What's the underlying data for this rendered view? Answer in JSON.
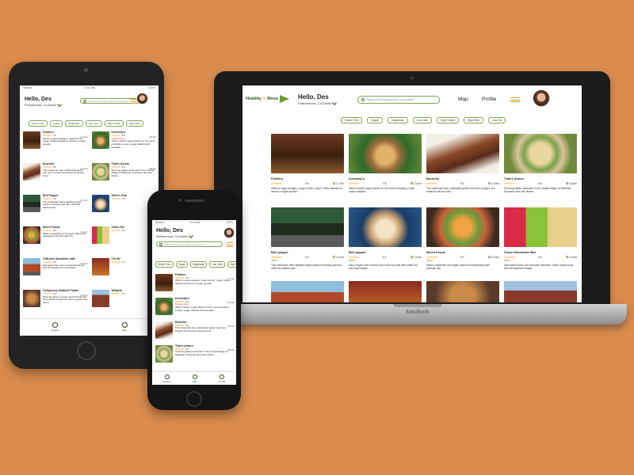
{
  "colors": {
    "background": "#DA8C4E",
    "accent_green": "#7fa64b",
    "star": "#f2a614",
    "open": "#5a9a2d",
    "closing": "#d9332b"
  },
  "user": {
    "greeting": "Hello, Des",
    "location": "Portmarnock, Co.Dublin"
  },
  "search": {
    "placeholder": "Search by business name or keyword"
  },
  "filters": [
    "Gluten Free",
    "Vegan",
    "Vegetarian",
    "Low Carb",
    "High Protein",
    "High Fibre",
    "Low Fat"
  ],
  "desktop": {
    "logo": {
      "word1": "Healthy",
      "word2": "Move"
    },
    "nav": {
      "map": "Map",
      "profile": "Profile"
    },
    "laptop_brand": "MacBook",
    "places": [
      {
        "name": "Fowlers",
        "stars": "★★★★★",
        "rating": "4.6",
        "distance": "1.7 km",
        "desc": "Offers a vegan lasagne, vegan burrito, vegan Chana Masala as well as a vegan special."
      },
      {
        "name": "Kennedy's",
        "stars": "★★★★★",
        "rating": "4.8",
        "distance": "2.4 km",
        "desc": "Offers marked vegan dishes on the menu including a super vegan ciabatta."
      },
      {
        "name": "Burnells",
        "stars": "★★★★★",
        "rating": "5.0",
        "distance": "2.3 km",
        "desc": "This restaurant has a dedicated gluten free fryer, burgers and bread as well as buns."
      },
      {
        "name": "That's Amore",
        "stars": "★★★★★",
        "rating": "5.0",
        "distance": "3.8 km",
        "desc": "Stunning Italian restaurant in the coastal village of Malahide. European and Irish dishes."
      },
      {
        "name": "Bell pepper",
        "stars": "★★★★★",
        "rating": "4.0",
        "distance": "2.1 km",
        "status": "Open",
        "desc": "This restaurant offers labelled vegan options including pad thai, chilli and cashew tofu."
      },
      {
        "name": "Bell pepper",
        "stars": "★★★★★",
        "rating": "5.0",
        "distance": "2.5 km",
        "status": "Open",
        "desc": "Has a vegan main meal for lunch and soy milk with coffee tea and extra charge."
      },
      {
        "name": "Merra Foods",
        "stars": "★★★★★",
        "rating": "5.0",
        "distance": "2.4 km",
        "status": "Open",
        "desc": "Makes vegetarian and vegan Indian food takeaways with karmatic rice."
      },
      {
        "name": "Zumo Smoothies Bar",
        "stars": "★★★★★",
        "rating": "4.6",
        "distance": "1.5 km",
        "status": "Open",
        "desc": "International juice and smoothie franchise. Offers snack foods like fruit salad and wraps."
      },
      {
        "name": "",
        "stars": "",
        "rating": "",
        "distance": "",
        "desc": ""
      },
      {
        "name": "",
        "stars": "",
        "rating": "",
        "distance": "",
        "desc": ""
      },
      {
        "name": "",
        "stars": "",
        "rating": "",
        "distance": "",
        "desc": ""
      },
      {
        "name": "",
        "stars": "",
        "rating": "",
        "distance": "",
        "desc": ""
      }
    ]
  },
  "tablet": {
    "status_left": "Sketch",
    "status_time": "9:41 AM",
    "status_right": "100%",
    "places": [
      {
        "name": "Fowlers",
        "stars": "★★★★★",
        "rating": "4.6",
        "distance": "1.7 km",
        "desc": "Offers a vegan lasagne, vegan burrito, vegan Chana Masala as well as a vegan special."
      },
      {
        "name": "Kennedy's",
        "stars": "★★★★★",
        "rating": "4.8",
        "distance": "2.4 km",
        "status": "Closing Soon",
        "desc": "Offers marked vegan dishes on the menu including a super vegan ciabatta with avocado."
      },
      {
        "name": "Burnells",
        "stars": "★★★★★",
        "rating": "5.0",
        "distance": "2.3 km",
        "desc": "This restaurant has a dedicated gluten free fryer, burgers and bread as well as buns."
      },
      {
        "name": "That's Amore",
        "stars": "★★★★★",
        "rating": "5.0",
        "distance": "3.8 km",
        "desc": "Stunning Italian restaurant in the coastal village of Malahide. European and Irish dishes."
      },
      {
        "name": "Bell Pepper",
        "stars": "★★★★★",
        "rating": "4.0",
        "distance": "2.1 km",
        "desc": "This restaurant offers labelled vegan options including pad thai, chilli and cashew tofu."
      },
      {
        "name": "Olive's Roo",
        "stars": "★★★★★",
        "rating": "4.5",
        "distance": "2.0 km",
        "desc": ""
      },
      {
        "name": "Merra Foods",
        "stars": "★★★★★",
        "rating": "5.0",
        "distance": "2.4 km",
        "desc": "Makes vegetarian and vegan Indian food takeaways with karmatic rice."
      },
      {
        "name": "Zumo Sm",
        "stars": "★★★★★",
        "rating": "4.6",
        "distance": "1.5 km",
        "desc": ""
      },
      {
        "name": "O'Briens Sandwich cafe",
        "stars": "★★★★★",
        "rating": "4.0",
        "distance": "2.6 km",
        "desc": "Has gluten free menu of sandwiches as well as breads buns and wraps."
      },
      {
        "name": "The Br",
        "stars": "★★★★★",
        "rating": "4.2",
        "distance": "1.9 km",
        "desc": ""
      },
      {
        "name": "Octopussy Seafood Tapas",
        "stars": "★★★★★",
        "rating": "4.5",
        "distance": "2.5 km",
        "desc": "Bring the glow in Howth. North Dublin this cosy seafood tapas bar offers a gluten free menu."
      },
      {
        "name": "Wrighte",
        "stars": "★★★★★",
        "rating": "4.3",
        "distance": "2.2 km",
        "desc": ""
      }
    ],
    "tabs": {
      "explore": "Explore",
      "map": "Map"
    }
  },
  "phone": {
    "status_left": "Sketch",
    "status_time": "9:41 AM",
    "status_right": "100%",
    "places": [
      {
        "name": "Fowlers",
        "stars": "★★★★★",
        "rating": "4.6",
        "distance": "1.7 km",
        "desc": "Offers a vegan lasagne, vegan burrito, vegan Chana Masala as well as a vegan special."
      },
      {
        "name": "Kennedy's",
        "stars": "★★★★★",
        "rating": "4.8",
        "distance": "2.4 km",
        "status": "Closing Soon",
        "desc": "Offers marked vegan dishes on the menu including a super vegan ciabatta with avocado."
      },
      {
        "name": "Burnells",
        "stars": "★★★★★",
        "rating": "5.0",
        "distance": "2.3 km",
        "desc": "This restaurant has a dedicated gluten free fryer, burgers and bread as well as buns."
      },
      {
        "name": "That's Amore",
        "stars": "★★★★★",
        "rating": "5.0",
        "distance": "3.8 km",
        "desc": "Stunning Italian restaurant in the coastal village of Malahide. European and Irish dishes."
      }
    ],
    "tabs": {
      "explore": "Explore",
      "map": "Map",
      "profile": "Profile"
    }
  }
}
